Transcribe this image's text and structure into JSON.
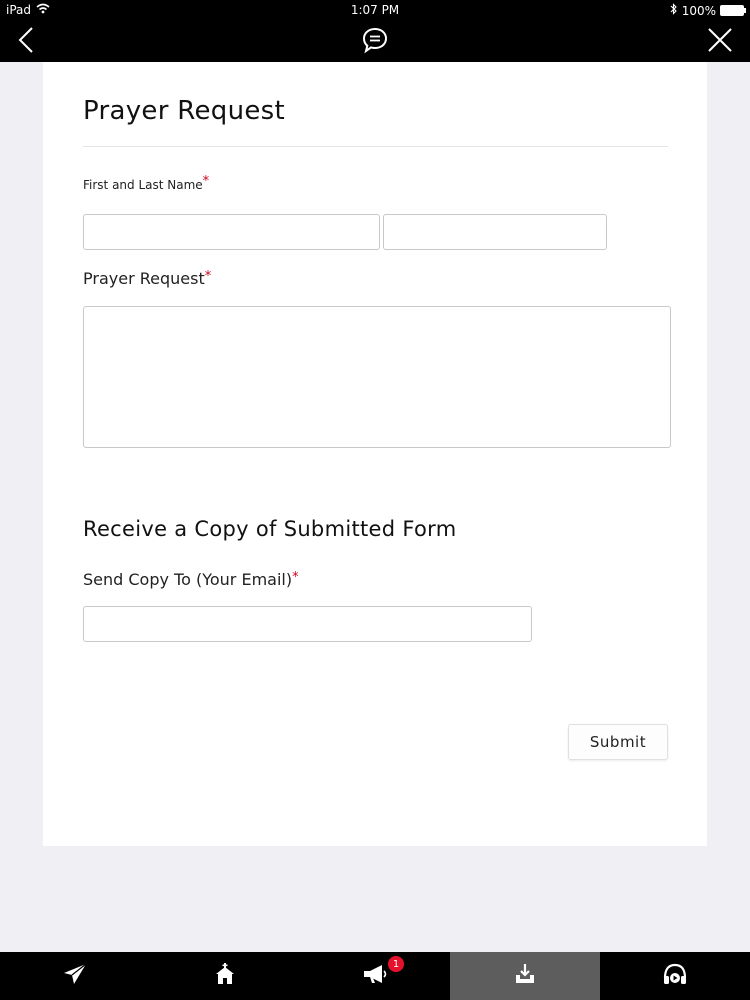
{
  "status_bar": {
    "device": "iPad",
    "time": "1:07 PM",
    "battery_text": "100%",
    "battery_level": 1.0
  },
  "nav": {
    "back_icon": "chevron-left-icon",
    "center_icon": "chat-bubble-icon",
    "close_icon": "close-icon"
  },
  "form": {
    "title": "Prayer Request",
    "name_label": "First and Last Name",
    "first_name_value": "",
    "last_name_value": "",
    "prayer_label": "Prayer Request",
    "prayer_value": "",
    "copy_section_title": "Receive a Copy of Submitted Form",
    "email_label": "Send Copy To (Your Email)",
    "email_value": "",
    "required_marker": "*",
    "submit_label": "Submit"
  },
  "tab_bar": {
    "items": [
      {
        "icon": "paper-plane-icon",
        "active": false
      },
      {
        "icon": "home-icon",
        "active": false
      },
      {
        "icon": "megaphone-icon",
        "active": false,
        "badge": "1"
      },
      {
        "icon": "download-tray-icon",
        "active": true
      },
      {
        "icon": "podcast-play-icon",
        "active": false
      }
    ]
  },
  "colors": {
    "bar_background": "#000000",
    "page_background": "#efeff4",
    "required": "#d0021b",
    "active_tab": "#5d5d5d",
    "badge": "#e6122b"
  }
}
